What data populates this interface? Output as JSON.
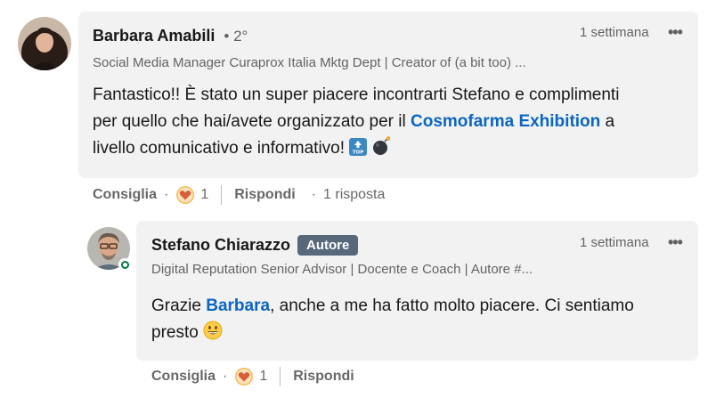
{
  "comment1": {
    "author": "Barbara Amabili",
    "degree": "• 2°",
    "headline": "Social Media Manager Curaprox Italia Mktg Dept | Creator of (a bit too) ...",
    "time": "1 settimana",
    "more_icon": "•••",
    "text_line1": "Fantastico!! È stato un super piacere incontrarti Stefano e complimenti",
    "text_line2_pre": "per quello che hai/avete organizzato per il ",
    "text_mention": "Cosmofarma Exhibition",
    "text_line2_post": " a",
    "text_line3": "livello comunicativo e informativo!",
    "emoji1": "top-arrow-icon",
    "emoji2": "bomb-icon",
    "like_label": "Consiglia",
    "reaction_count": "1",
    "reply_label": "Rispondi",
    "replies_text": "1 risposta",
    "dot": "·"
  },
  "comment2": {
    "author": "Stefano Chiarazzo",
    "badge": "Autore",
    "headline": "Digital Reputation Senior Advisor | Docente e Coach | Autore #...",
    "time": "1 settimana",
    "more_icon": "•••",
    "text_pre": "Grazie ",
    "text_mention": "Barbara",
    "text_line1_post": ", anche a me ha fatto molto piacere. Ci sentiamo",
    "text_line2": "presto",
    "emoji": "grinning-face-icon",
    "like_label": "Consiglia",
    "reaction_count": "1",
    "reply_label": "Rispondi",
    "dot": "·"
  },
  "colors": {
    "bubble_bg": "#f2f2f2",
    "mention": "#0a66c2",
    "badge_bg": "#56687a",
    "heart_reaction": "#d65e3c",
    "online": "#057642"
  }
}
